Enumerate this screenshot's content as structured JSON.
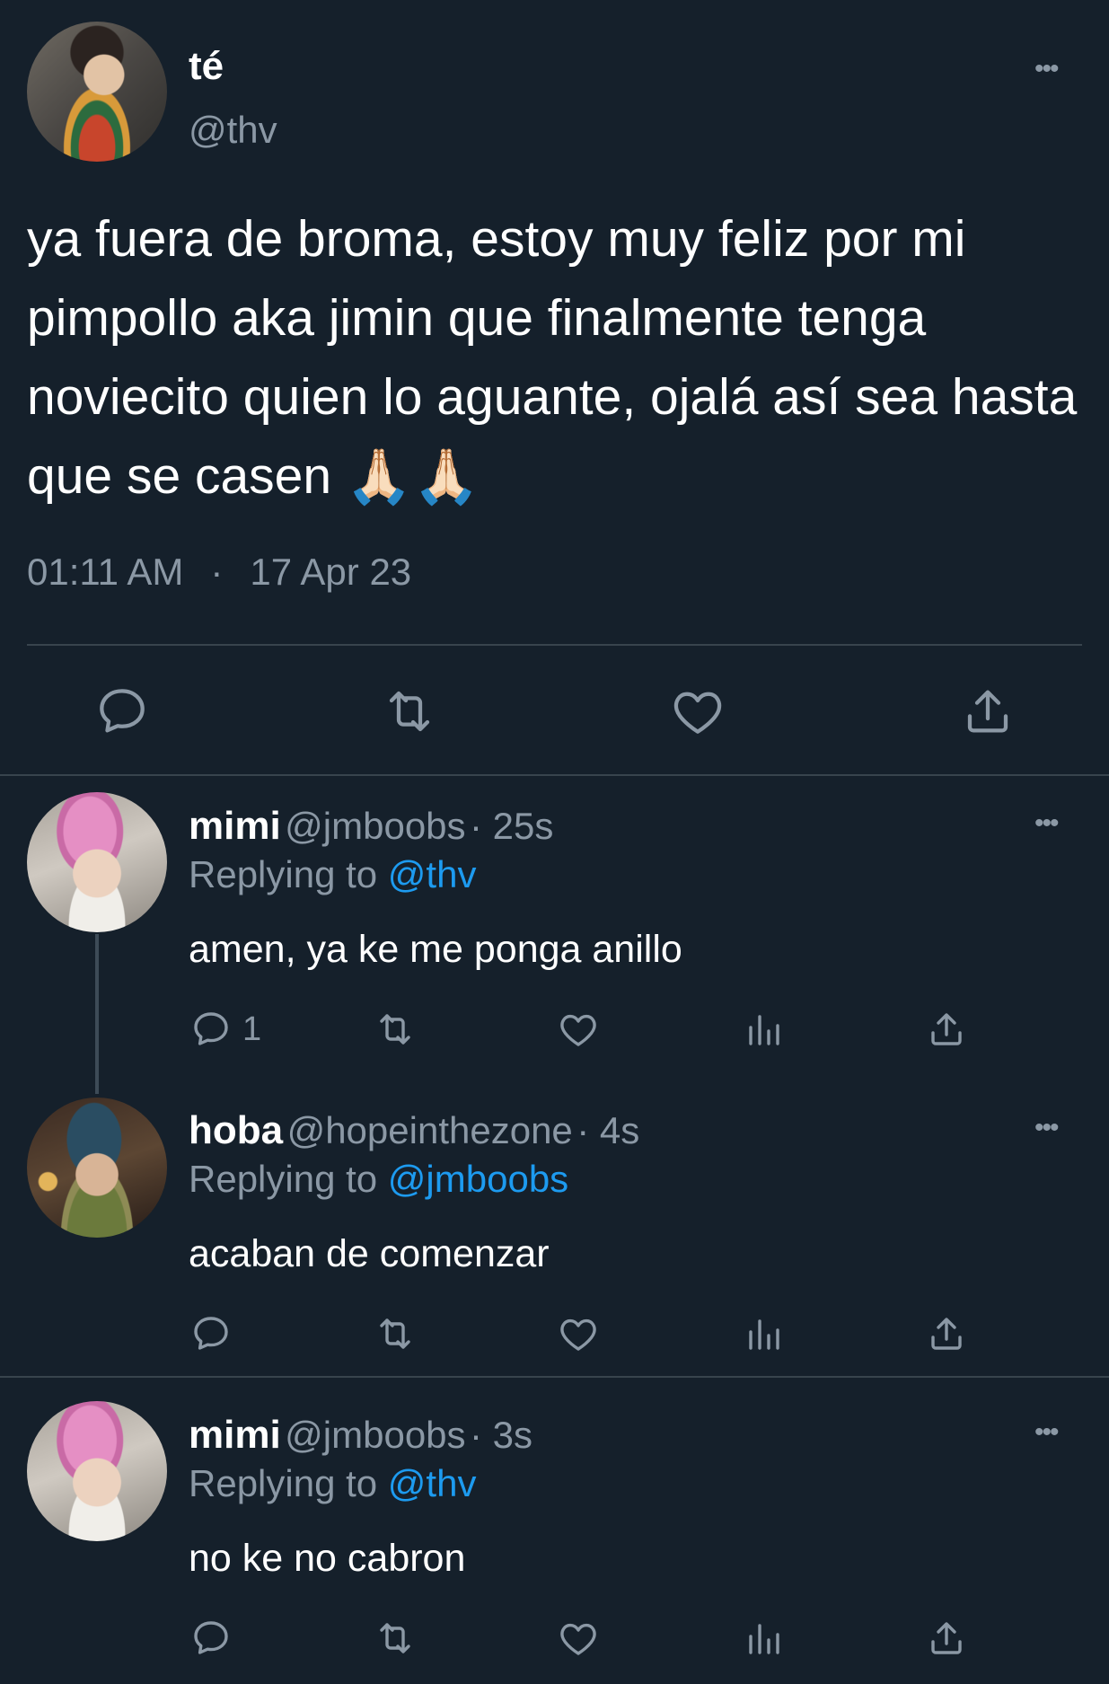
{
  "main_tweet": {
    "display_name": "té",
    "handle": "@thv",
    "text": "ya fuera de broma, estoy muy feliz por mi pimpollo aka jimin que finalmente tenga noviecito quien lo aguante, ojalá así sea hasta que se casen",
    "emoji": "🙏🏻🙏🏻",
    "time": "01:11 AM",
    "separator": "·",
    "date": "17 Apr 23",
    "more_label": "•••",
    "actions": [
      "reply-icon",
      "retweet-icon",
      "like-icon",
      "share-icon"
    ]
  },
  "replies": [
    {
      "display_name": "mimi",
      "handle": "@jmboobs",
      "age": "· 25s",
      "replying_prefix": "Replying to",
      "replying_to": "@thv",
      "text": "amen, ya ke me ponga anillo",
      "reply_count": "1",
      "more_label": "•••"
    },
    {
      "display_name": "hoba",
      "handle": "@hopeinthezone",
      "age": "· 4s",
      "replying_prefix": "Replying to",
      "replying_to": "@jmboobs",
      "text": "acaban de comenzar",
      "reply_count": "",
      "more_label": "•••"
    },
    {
      "display_name": "mimi",
      "handle": "@jmboobs",
      "age": "· 3s",
      "replying_prefix": "Replying to",
      "replying_to": "@thv",
      "text": "no ke no cabron",
      "reply_count": "",
      "more_label": "•••"
    }
  ],
  "colors": {
    "background": "#15202b",
    "secondary_text": "#8b98a5",
    "link": "#1d9bf0",
    "divider": "#38444d"
  }
}
